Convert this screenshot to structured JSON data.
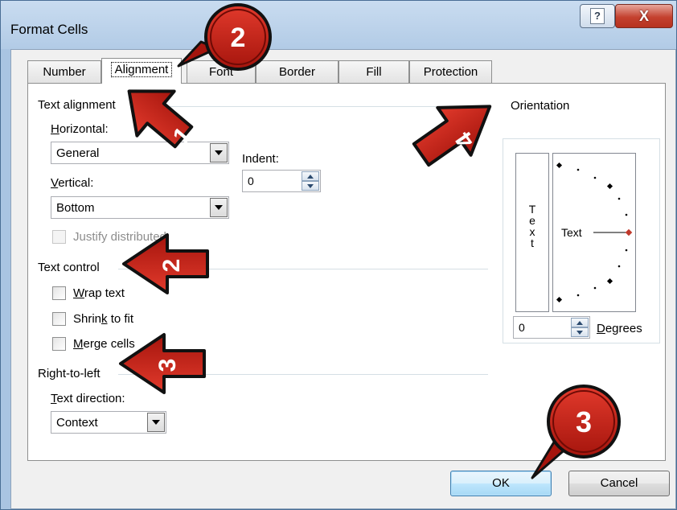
{
  "window": {
    "title": "Format Cells",
    "help_glyph": "?",
    "close_glyph": "X"
  },
  "tabs": [
    {
      "label": "Number",
      "active": false
    },
    {
      "label": "Alignment",
      "active": true
    },
    {
      "label": "Font",
      "active": false
    },
    {
      "label": "Border",
      "active": false
    },
    {
      "label": "Fill",
      "active": false
    },
    {
      "label": "Protection",
      "active": false
    }
  ],
  "text_alignment": {
    "group_label": "Text alignment",
    "horizontal_label_u": "H",
    "horizontal_label_rest": "orizontal:",
    "horizontal_value": "General",
    "vertical_label_u": "V",
    "vertical_label_rest": "ertical:",
    "vertical_value": "Bottom",
    "indent_label": "Indent:",
    "indent_value": "0",
    "justify_label": "Justify distributed"
  },
  "text_control": {
    "group_label": "Text control",
    "wrap_u": "W",
    "wrap_rest": "rap text",
    "shrink_pre": "Shrin",
    "shrink_u": "k",
    "shrink_post": " to fit",
    "merge_u": "M",
    "merge_rest": "erge cells"
  },
  "right_to_left": {
    "group_label": "Right-to-left",
    "direction_u": "T",
    "direction_rest": "ext direction:",
    "direction_value": "Context"
  },
  "orientation": {
    "group_label": "Orientation",
    "vertical_text": [
      "T",
      "e",
      "x",
      "t"
    ],
    "dial_text": "Text",
    "degrees_value": "0",
    "degrees_u": "D",
    "degrees_rest": "egrees"
  },
  "buttons": {
    "ok": "OK",
    "cancel": "Cancel"
  },
  "callouts": {
    "arrow_1": "1",
    "arrow_2": "2",
    "arrow_3": "3",
    "arrow_4": "4",
    "circle_2": "2",
    "circle_3": "3"
  },
  "colors": {
    "callout_red": "#c8241a",
    "callout_dark_red": "#7a0e08",
    "dial_marker": "#c0392b"
  }
}
